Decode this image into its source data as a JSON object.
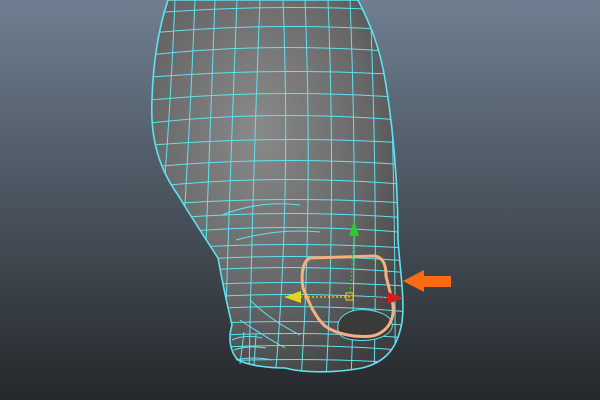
{
  "viewport": {
    "background_top": "#6f7f91",
    "background_bottom": "#25282b"
  },
  "mesh": {
    "surface_color": "#6b6b6b",
    "wire_color": "#5fe2f2"
  },
  "selection": {
    "outline_color": "#f3b183"
  },
  "manipulator": {
    "x_axis_color": "#d61c1c",
    "y_axis_color": "#2ec832",
    "z_axis_color": "#e6d51c"
  },
  "annotation": {
    "arrow_color": "#ff6a14",
    "arrow_icon": "left-arrow-icon"
  }
}
